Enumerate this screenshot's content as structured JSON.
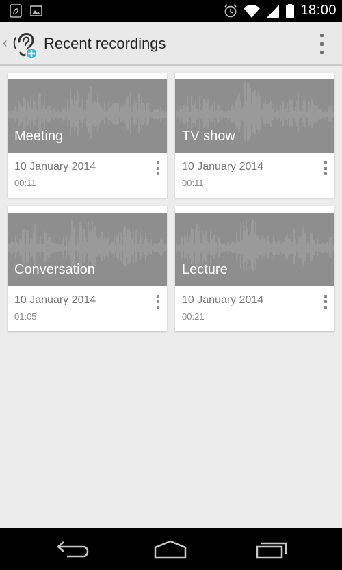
{
  "status_bar": {
    "time": "18:00",
    "left_icons": [
      "app-notification-icon",
      "image-icon"
    ],
    "right_icons": [
      "alarm-icon",
      "wifi-icon",
      "signal-icon",
      "battery-icon"
    ]
  },
  "action_bar": {
    "title": "Recent recordings",
    "app_icon": "ear-plus-icon",
    "overflow_icon": "overflow-menu-icon"
  },
  "recordings": [
    {
      "title": "Meeting",
      "date": "10 January 2014",
      "duration": "00:11"
    },
    {
      "title": "TV show",
      "date": "10 January 2014",
      "duration": "00:11"
    },
    {
      "title": "Conversation",
      "date": "10 January 2014",
      "duration": "01:05"
    },
    {
      "title": "Lecture",
      "date": "10 January 2014",
      "duration": "00:21"
    }
  ],
  "nav_bar": {
    "buttons": [
      "back-icon",
      "home-icon",
      "recent-apps-icon"
    ]
  },
  "colors": {
    "accent": "#33b5e5",
    "waveform_bg": "#8e8e8e",
    "background": "#ececec"
  }
}
